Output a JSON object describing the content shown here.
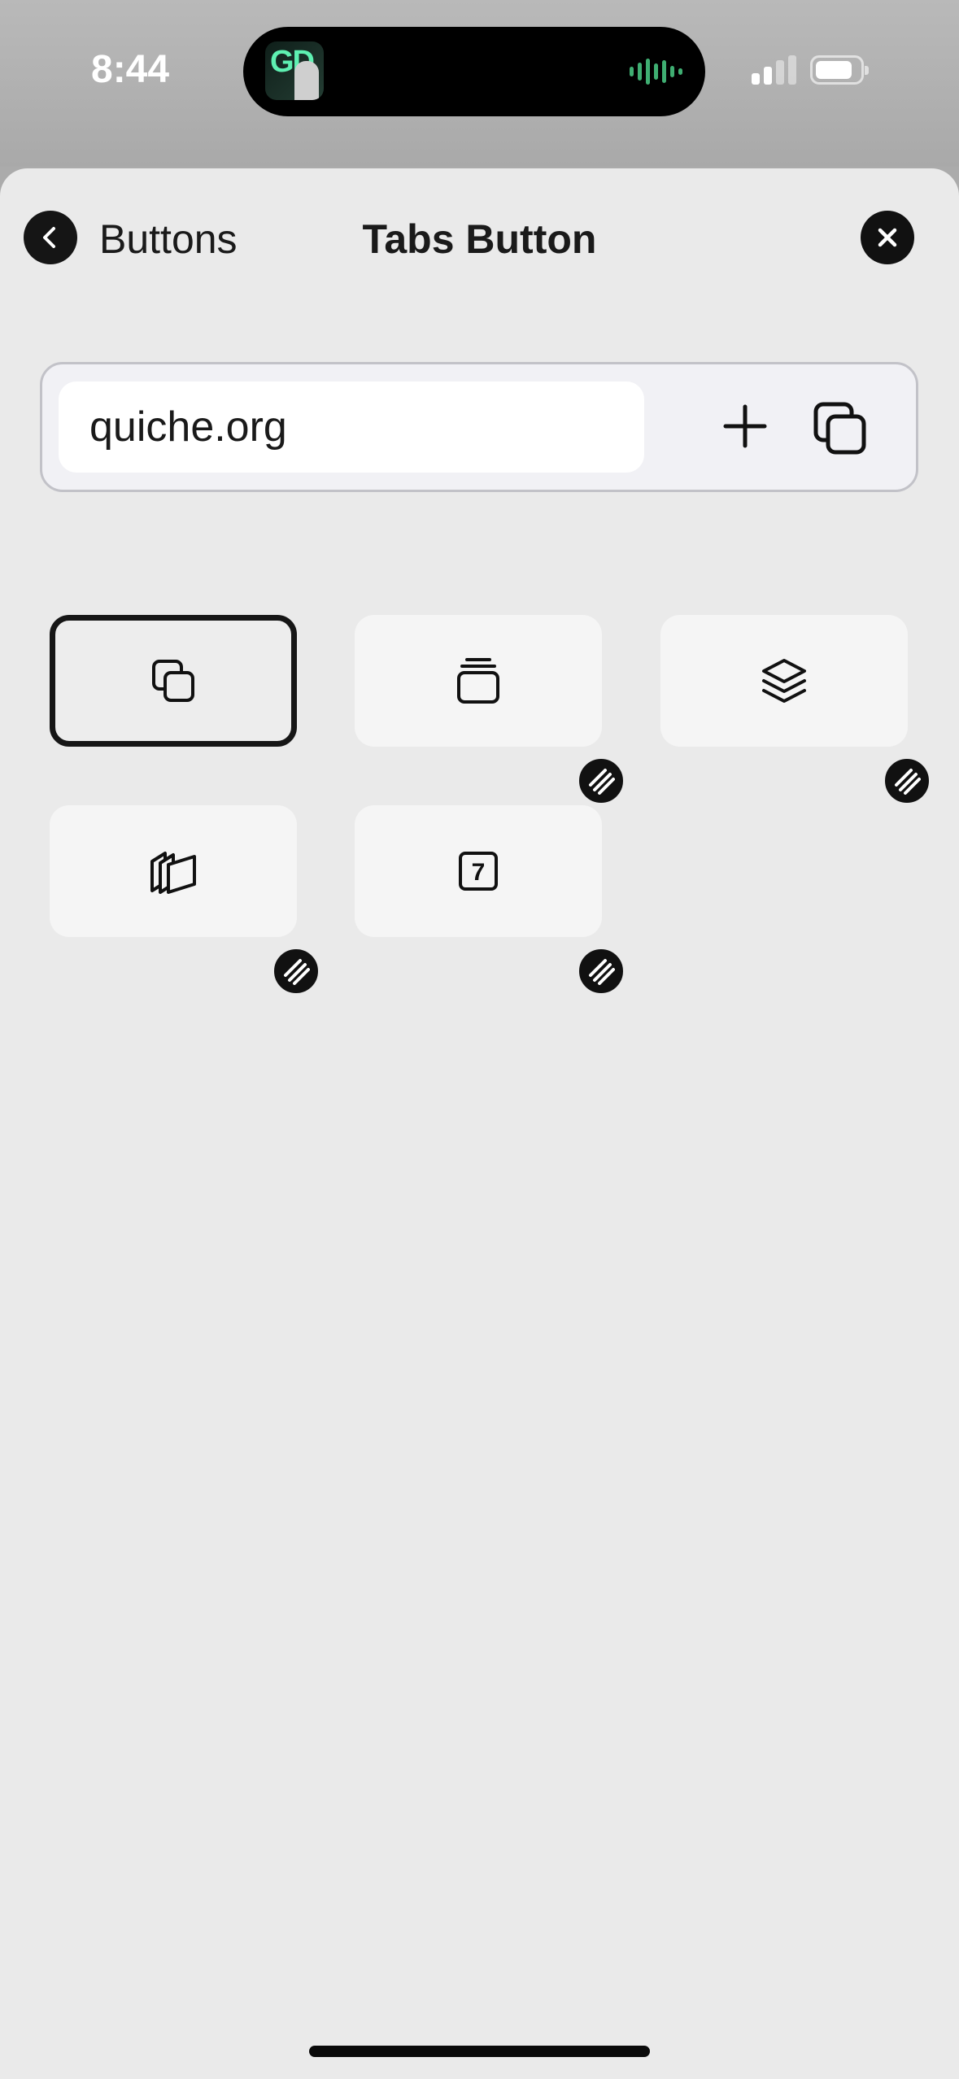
{
  "status_bar": {
    "time": "8:44"
  },
  "nav": {
    "back_label": "Buttons",
    "title": "Tabs Button"
  },
  "browser_preview": {
    "url": "quiche.org"
  },
  "icons": {
    "back": "chevron-left-icon",
    "close": "close-icon",
    "new_tab": "plus-icon",
    "tabs": "tabs-icon",
    "tile_styles": [
      "overlapping-squares-icon",
      "stacked-cards-icon",
      "layers-icon",
      "slanted-stack-icon",
      "tab-count-icon"
    ],
    "locked_badge": "striped-badge-icon"
  },
  "tile_count_label": "7",
  "colors": {
    "sheet_bg": "#eaeaea",
    "accent_dark": "#111111",
    "tile_bg": "#f5f5f5"
  }
}
